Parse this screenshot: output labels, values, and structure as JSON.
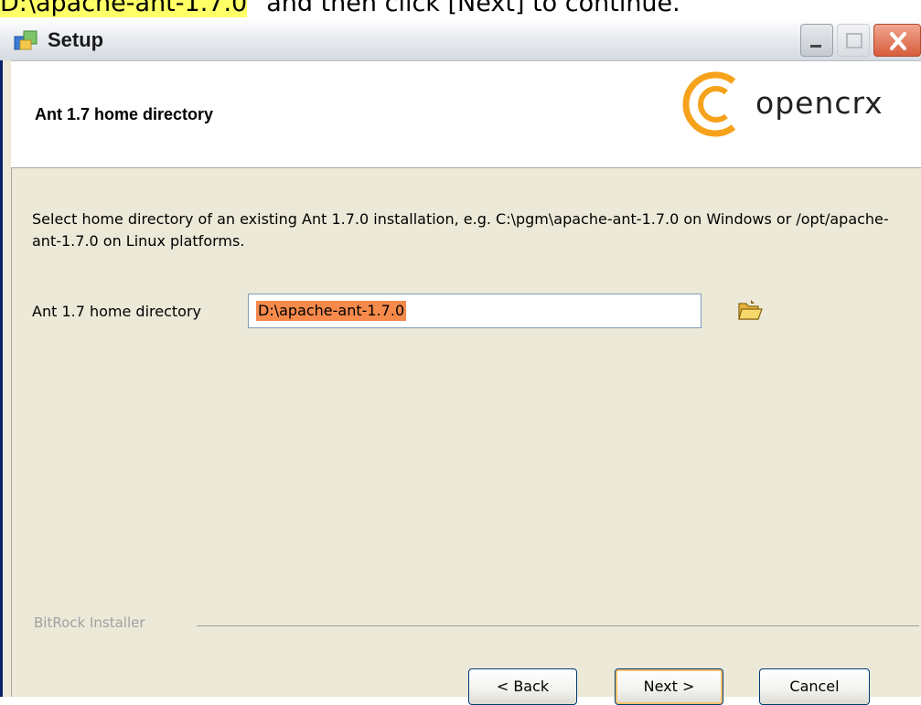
{
  "caption": {
    "highlight": "D:\\apache-ant-1.7.0",
    "rest": "\" and then click [Next] to continue."
  },
  "window": {
    "title": "Setup",
    "icon": "setup-icon",
    "controls": [
      "minimize-icon",
      "maximize-icon",
      "close-icon"
    ]
  },
  "header": {
    "title": "Ant 1.7 home directory",
    "logo_text": "opencrx",
    "logo_color": "#f7a21b"
  },
  "body": {
    "description": "Select home directory of an existing Ant 1.7.0 installation, e.g. C:\\pgm\\apache-ant-1.7.0 on Windows or /opt/apache-ant-1.7.0 on Linux platforms.",
    "field_label": "Ant 1.7 home directory",
    "field_value": "D:\\apache-ant-1.7.0",
    "browse_icon": "folder-open-icon"
  },
  "footer": {
    "group_label": "BitRock Installer",
    "back_label": "< Back",
    "next_label": "Next >",
    "cancel_label": "Cancel"
  }
}
